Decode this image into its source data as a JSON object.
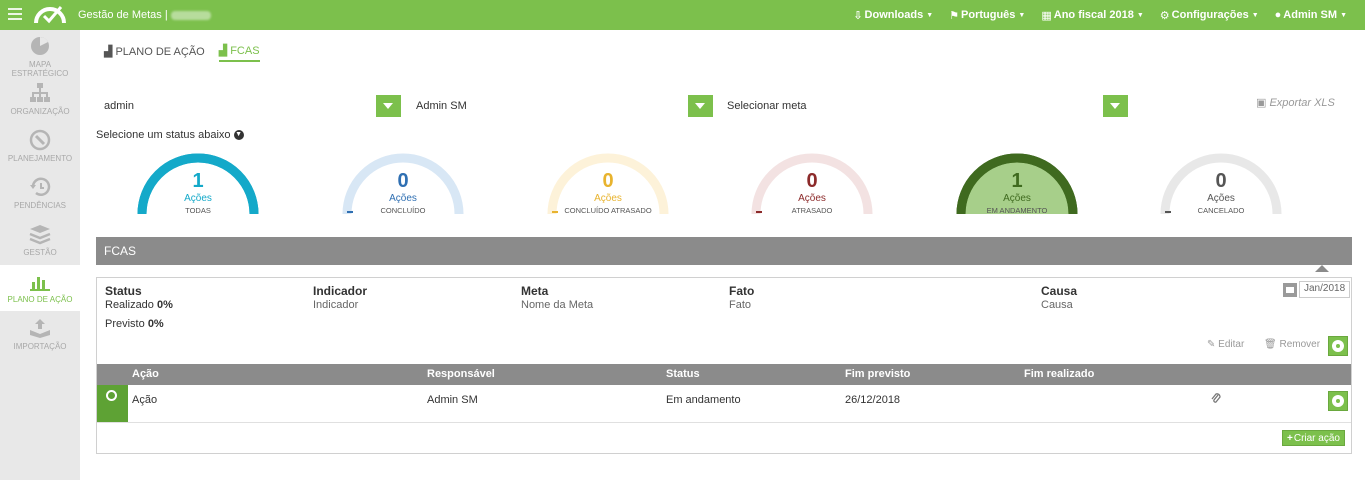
{
  "header": {
    "title": "Gestão de Metas |",
    "menu": [
      {
        "icon": "download-icon",
        "label": "Downloads"
      },
      {
        "icon": "flag-icon",
        "label": "Português"
      },
      {
        "icon": "calendar-icon",
        "label": "Ano fiscal 2018"
      },
      {
        "icon": "gear-icon",
        "label": "Configurações"
      },
      {
        "icon": "user-icon",
        "label": "Admin SM"
      }
    ]
  },
  "sidebar": {
    "items": [
      {
        "label": "MAPA ESTRATÉGICO",
        "icon": "pie-chart-icon"
      },
      {
        "label": "ORGANIZAÇÃO",
        "icon": "org-chart-icon"
      },
      {
        "label": "PLANEJAMENTO",
        "icon": "compass-icon"
      },
      {
        "label": "PENDÊNCIAS",
        "icon": "history-icon"
      },
      {
        "label": "GESTÃO",
        "icon": "stack-icon"
      },
      {
        "label": "PLANO DE AÇÃO",
        "icon": "bar-chart-icon"
      },
      {
        "label": "IMPORTAÇÃO",
        "icon": "upload-tray-icon"
      }
    ]
  },
  "tabs": [
    {
      "label": "PLANO DE AÇÃO",
      "icon": "bar-chart-icon"
    },
    {
      "label": "FCAS",
      "icon": "bar-chart-icon"
    }
  ],
  "filters": {
    "user": "admin",
    "responsible": "Admin SM",
    "goal": "Selecionar meta",
    "export_label": "Exportar XLS"
  },
  "status_hint": "Selecione um status abaixo",
  "gauges": [
    {
      "count": "1",
      "sub": "Ações",
      "label": "TODAS",
      "color": "#14a9c9",
      "track": "#14a9c9",
      "fill": "#ffffff",
      "text_color": "#14a9c9",
      "level": 1
    },
    {
      "count": "0",
      "sub": "Ações",
      "label": "CONCLUÍDO",
      "color": "#2f6fb2",
      "track": "#d8e7f5",
      "fill": "#ffffff",
      "text_color": "#2f6fb2",
      "level": 0
    },
    {
      "count": "0",
      "sub": "Ações",
      "label": "CONCLUÍDO ATRASADO",
      "color": "#e8b32e",
      "track": "#fdf2d9",
      "fill": "#ffffff",
      "text_color": "#e8b32e",
      "level": 0
    },
    {
      "count": "0",
      "sub": "Ações",
      "label": "ATRASADO",
      "color": "#8c2a2a",
      "track": "#f3e2e2",
      "fill": "#ffffff",
      "text_color": "#8c2a2a",
      "level": 0
    },
    {
      "count": "1",
      "sub": "Ações",
      "label": "EM ANDAMENTO",
      "color": "#3f6a1f",
      "track": "#3f6a1f",
      "fill": "#a7cf8a",
      "text_color": "#3f6a1f",
      "level": 1
    },
    {
      "count": "0",
      "sub": "Ações",
      "label": "CANCELADO",
      "color": "#555555",
      "track": "#e8e8e8",
      "fill": "#ffffff",
      "text_color": "#555555",
      "level": 0
    }
  ],
  "section": {
    "title": "FCAS"
  },
  "card": {
    "status_header": "Status",
    "realizado_label": "Realizado",
    "realizado_value": "0%",
    "previsto_label": "Previsto",
    "previsto_value": "0%",
    "indicador_header": "Indicador",
    "indicador_value": "Indicador",
    "meta_header": "Meta",
    "meta_value": "Nome da Meta",
    "fato_header": "Fato",
    "fato_value": "Fato",
    "causa_header": "Causa",
    "causa_value": "Causa",
    "date": "Jan/2018",
    "edit_label": "Editar",
    "remove_label": "Remover"
  },
  "actions_table": {
    "columns": [
      "Ação",
      "Responsável",
      "Status",
      "Fim previsto",
      "Fim realizado"
    ],
    "rows": [
      {
        "acao": "Ação",
        "responsavel": "Admin SM",
        "status": "Em andamento",
        "fim_previsto": "26/12/2018",
        "fim_realizado": ""
      }
    ],
    "create_label": "Criar ação"
  },
  "colors": {
    "brand": "#7cc04c",
    "header_gray": "#8b8b8b"
  }
}
